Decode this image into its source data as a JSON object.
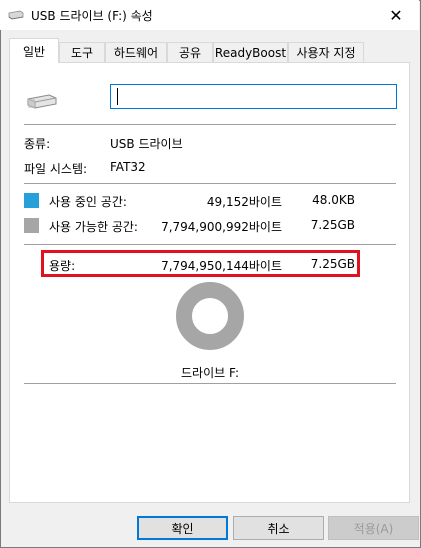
{
  "window": {
    "title": "USB 드라이브 (F:) 속성",
    "close_glyph": "✕"
  },
  "tabs": [
    {
      "label": "일반",
      "active": true
    },
    {
      "label": "도구",
      "active": false
    },
    {
      "label": "하드웨어",
      "active": false
    },
    {
      "label": "공유",
      "active": false
    },
    {
      "label": "ReadyBoost",
      "active": false
    },
    {
      "label": "사용자 지정",
      "active": false
    }
  ],
  "general": {
    "name_value": "",
    "type_label": "종류:",
    "type_value": "USB 드라이브",
    "fs_label": "파일 시스템:",
    "fs_value": "FAT32",
    "used": {
      "label": "사용 중인 공간:",
      "bytes": "49,152바이트",
      "size": "48.0KB",
      "color": "#26a0da"
    },
    "free": {
      "label": "사용 가능한 공간:",
      "bytes": "7,794,900,992바이트",
      "size": "7.25GB",
      "color": "#a6a6a6"
    },
    "capacity": {
      "label": "용량:",
      "bytes": "7,794,950,144바이트",
      "size": "7.25GB"
    },
    "drive_caption": "드라이브 F:",
    "used_fraction": 6.3e-06,
    "highlight_color": "#e0121f"
  },
  "buttons": {
    "ok": "확인",
    "cancel": "취소",
    "apply": "적용(A)"
  }
}
